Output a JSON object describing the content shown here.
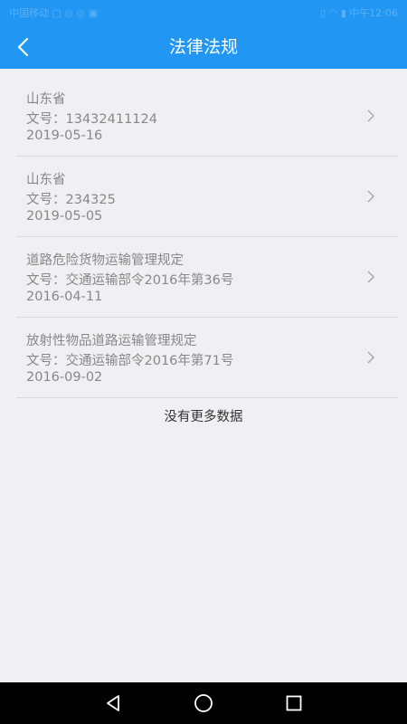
{
  "status_bar": {
    "left": "中国移动 ▢ ◎ ◎ ▣",
    "right": "▯ ◠ ▮ 中午12:06"
  },
  "header": {
    "title": "法律法规",
    "back_icon": "back-arrow-icon"
  },
  "list": {
    "items": [
      {
        "title": "山东省",
        "doc_no": "文号：13432411124",
        "date": "2019-05-16"
      },
      {
        "title": "山东省",
        "doc_no": "文号：234325",
        "date": "2019-05-05"
      },
      {
        "title": "道路危险货物运输管理规定",
        "doc_no": "文号：交通运输部令2016年第36号",
        "date": "2016-04-11"
      },
      {
        "title": "放射性物品道路运输管理规定",
        "doc_no": "文号：交通运输部令2016年第71号",
        "date": "2016-09-02"
      }
    ]
  },
  "footer_text": "没有更多数据",
  "nav_bar": {
    "icons": [
      "back-triangle-icon",
      "home-circle-icon",
      "recents-square-icon"
    ]
  },
  "colors": {
    "primary": "#2196f3",
    "background": "#efeff4",
    "text_secondary": "#888888",
    "divider": "#d9d9de"
  }
}
